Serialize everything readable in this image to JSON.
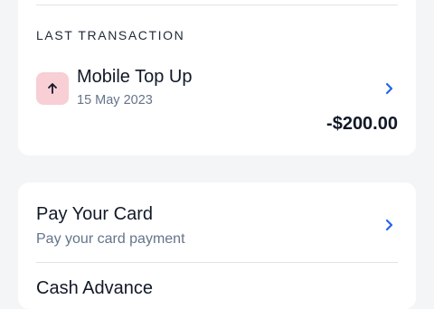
{
  "last_transaction": {
    "section_title": "LAST TRANSACTION",
    "name": "Mobile Top Up",
    "date": "15 May 2023",
    "amount": "-$200.00",
    "icon": "arrow-up-icon",
    "icon_bg": "#f7cfd5"
  },
  "actions": [
    {
      "title": "Pay Your Card",
      "subtitle": "Pay your card payment"
    },
    {
      "title": "Cash Advance"
    }
  ],
  "colors": {
    "background": "#f4f5f7",
    "card": "#ffffff",
    "accent": "#2563eb",
    "muted_text": "#64748b"
  }
}
